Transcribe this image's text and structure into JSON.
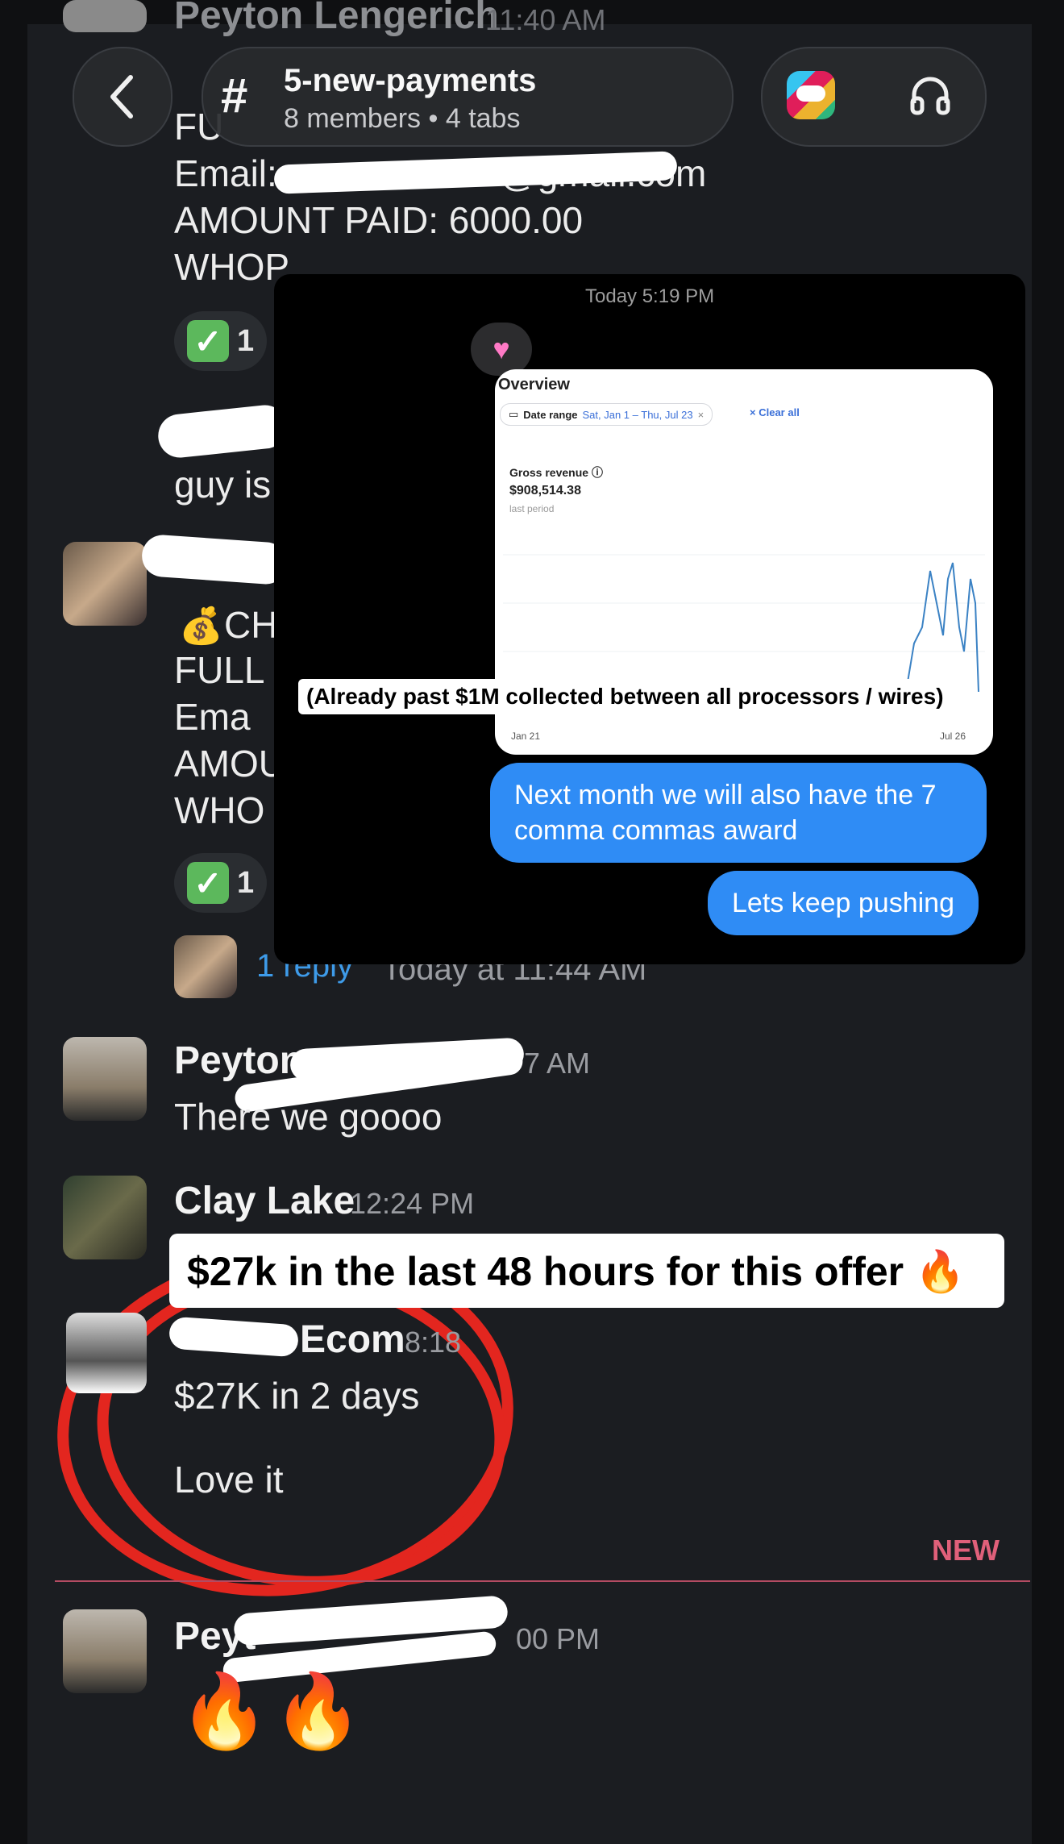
{
  "channel": {
    "hash": "#",
    "name": "5-new-payments",
    "meta": "8 members • 4 tabs",
    "back_icon": "chevron-left-icon",
    "app_icon": "slack-app-icon",
    "huddle_icon": "headphones-icon"
  },
  "top_post": {
    "author_partial": "Peyton Lengerich",
    "time_partial": "11:40 AM",
    "line_partial": "FU",
    "email_label": "Email:",
    "email_partial": "@gmail.com",
    "amount": "AMOUNT PAID: 6000.00",
    "source": "WHOP",
    "reaction_count": "1"
  },
  "mid_post": {
    "text_partial": "guy is",
    "line1": "CH",
    "line2": "FULL",
    "line3": "Ema",
    "line4": "AMOU",
    "line5": "WHO",
    "reaction_count": "1",
    "reply_link": "1 reply",
    "reply_time": "Today at 11:44 AM"
  },
  "overlay": {
    "timestamp": "Today 5:19 PM",
    "card_title": "Overview",
    "date_range_label": "Date range",
    "date_range_value": "Sat, Jan 1 – Thu, Jul 23",
    "clear_all": "Clear all",
    "metric_label": "Gross revenue",
    "metric_value": "$908,514.38",
    "metric_sub": "last period",
    "x_start": "Jan 21",
    "x_end": "Jul 26",
    "caption": "(Already past $1M collected between all processors / wires)",
    "bubble1": "Next month we will also have the 7 comma commas award",
    "bubble2": "Lets keep pushing"
  },
  "messages": [
    {
      "author": "Peyton",
      "time": "7 AM",
      "text": "There we goooo"
    },
    {
      "author": "Clay Lake",
      "time": "12:24 PM"
    },
    {
      "author": "Ecom",
      "time": "8:18",
      "text1": "$27K in 2 days",
      "text2": "Love it"
    },
    {
      "author": "Peyt",
      "time": "00 PM",
      "text": "🔥🔥"
    }
  ],
  "highlight_caption": "$27k in the last 48 hours for this offer 🔥",
  "new_divider": "NEW",
  "colors": {
    "accent_blue": "#2f8cf5",
    "new_red": "#e0607a",
    "circle_red": "#e3261f",
    "check_green": "#5cb85c"
  }
}
